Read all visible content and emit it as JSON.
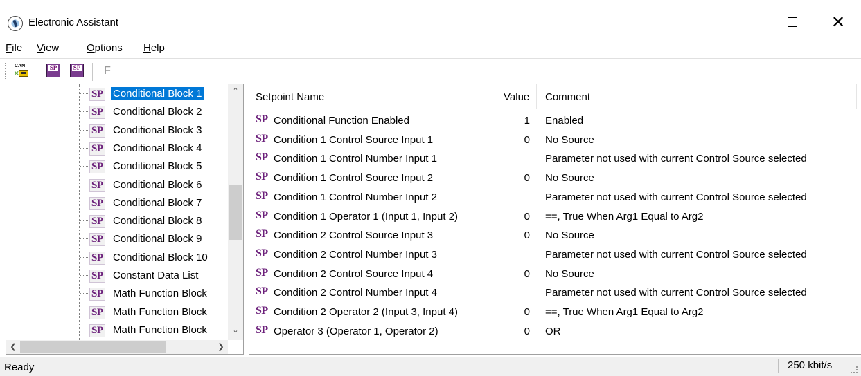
{
  "window": {
    "title": "Electronic Assistant",
    "controls": {
      "minimize": "minimize",
      "maximize": "maximize",
      "close": "close"
    }
  },
  "menu": [
    {
      "label": "File",
      "accel": "F",
      "rest": "ile"
    },
    {
      "label": "View",
      "accel": "V",
      "rest": "iew"
    },
    {
      "label": "Options",
      "accel": "O",
      "rest": "ptions"
    },
    {
      "label": "Help",
      "accel": "H",
      "rest": "elp"
    }
  ],
  "toolbar": {
    "can_icon_label": "CAN",
    "open_sp_label": "SP",
    "save_sp_label": "SP",
    "f_button_label": "F"
  },
  "tree": {
    "badge": "SP",
    "items": [
      {
        "label": "Conditional Block 1",
        "selected": true
      },
      {
        "label": "Conditional Block 2"
      },
      {
        "label": "Conditional Block 3"
      },
      {
        "label": "Conditional Block 4"
      },
      {
        "label": "Conditional Block 5"
      },
      {
        "label": "Conditional Block 6"
      },
      {
        "label": "Conditional Block 7"
      },
      {
        "label": "Conditional Block 8"
      },
      {
        "label": "Conditional Block 9"
      },
      {
        "label": "Conditional Block 10"
      },
      {
        "label": "Constant Data List"
      },
      {
        "label": "Math Function Block"
      },
      {
        "label": "Math Function Block"
      },
      {
        "label": "Math Function Block"
      }
    ],
    "scroll_up": "^",
    "scroll_down": "v",
    "scroll_left": "<",
    "scroll_right": ">"
  },
  "grid": {
    "columns": [
      "Setpoint Name",
      "Value",
      "Comment"
    ],
    "badge": "SP",
    "rows": [
      {
        "name": "Conditional Function Enabled",
        "value": "1",
        "comment": "Enabled"
      },
      {
        "name": "Condition 1 Control Source Input 1",
        "value": "0",
        "comment": "No Source"
      },
      {
        "name": "Condition 1 Control Number Input 1",
        "value": "",
        "comment": "Parameter not used with current Control Source selected"
      },
      {
        "name": "Condition 1 Control Source Input 2",
        "value": "0",
        "comment": "No Source"
      },
      {
        "name": "Condition 1 Control Number Input 2",
        "value": "",
        "comment": "Parameter not used with current Control Source selected"
      },
      {
        "name": "Condition 1 Operator 1 (Input 1, Input 2)",
        "value": "0",
        "comment": "==, True When Arg1 Equal to Arg2"
      },
      {
        "name": "Condition 2 Control Source Input 3",
        "value": "0",
        "comment": "No Source"
      },
      {
        "name": "Condition 2 Control Number Input 3",
        "value": "",
        "comment": "Parameter not used with current Control Source selected"
      },
      {
        "name": "Condition 2 Control Source Input 4",
        "value": "0",
        "comment": "No Source"
      },
      {
        "name": "Condition 2 Control Number Input 4",
        "value": "",
        "comment": "Parameter not used with current Control Source selected"
      },
      {
        "name": "Condition 2 Operator 2 (Input 3, Input 4)",
        "value": "0",
        "comment": "==, True When Arg1 Equal to Arg2"
      },
      {
        "name": "Operator 3 (Operator 1, Operator 2)",
        "value": "0",
        "comment": "OR"
      }
    ]
  },
  "status": {
    "text": "Ready",
    "bitrate": "250 kbit/s"
  },
  "colors": {
    "selection": "#0078d7",
    "sp_badge": "#6b1f7a"
  }
}
